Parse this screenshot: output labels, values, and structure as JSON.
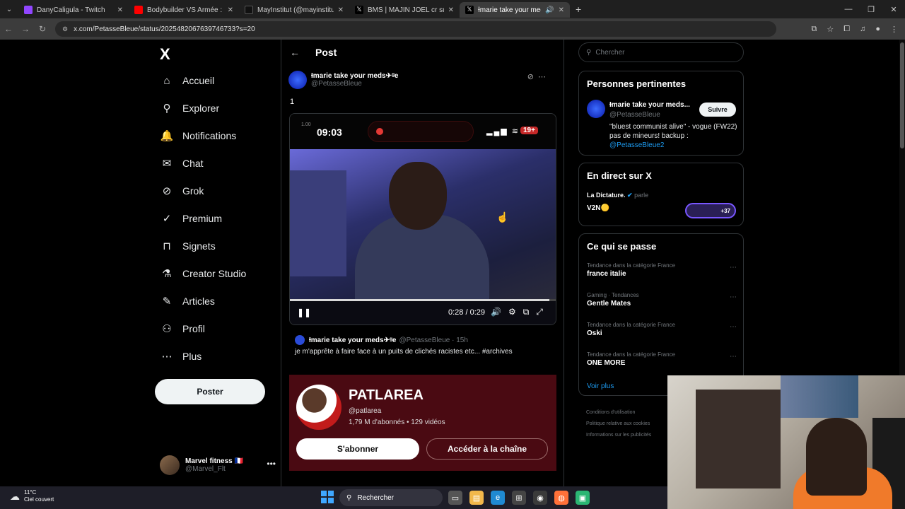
{
  "browser": {
    "tabs": [
      {
        "title": "DanyCaligula - Twitch",
        "color": "#9146ff"
      },
      {
        "title": "Bodybuilder VS Armée : qui ser",
        "color": "#ff0000"
      },
      {
        "title": "MayInstitut (@mayinstitut) | Tik",
        "color": "#111111"
      },
      {
        "title": "BMS | MAJIN JOEL cr sur X : \"@",
        "color": "#000000"
      },
      {
        "title": "Ɨmarie take your meds✈ᵍe",
        "color": "#000000"
      }
    ],
    "url": "x.com/PetasseBleue/status/2025482067639746733?s=20"
  },
  "nav": {
    "logo": "X",
    "items": [
      {
        "label": "Accueil",
        "icon": "⌂"
      },
      {
        "label": "Explorer",
        "icon": "⚲"
      },
      {
        "label": "Notifications",
        "icon": "🔔"
      },
      {
        "label": "Chat",
        "icon": "✉"
      },
      {
        "label": "Grok",
        "icon": "⊘"
      },
      {
        "label": "Premium",
        "icon": "✓"
      },
      {
        "label": "Signets",
        "icon": "⊓"
      },
      {
        "label": "Creator Studio",
        "icon": "⚗"
      },
      {
        "label": "Articles",
        "icon": "✎"
      },
      {
        "label": "Profil",
        "icon": "⚇"
      },
      {
        "label": "Plus",
        "icon": "⋯"
      }
    ],
    "post_button": "Poster",
    "account": {
      "name": "Marvel fitness 🇫🇷",
      "handle": "@Marvel_Flt"
    }
  },
  "main": {
    "header": "Post",
    "tweet": {
      "name": "Ɨmarie take your meds✈ᵍe",
      "handle": "@PetasseBleue",
      "text": "1"
    },
    "video": {
      "phone_time": "09:03",
      "phone_small": "1.00",
      "battery": "19+",
      "time": "0:28 / 0:29",
      "progress": 0.97
    },
    "quote": {
      "name": "Ɨmarie take your meds✈ᵍe",
      "handle": "@PetasseBleue · 15h",
      "text": "je m'apprête à faire face à un puits de clichés racistes etc... #archives"
    },
    "youtube": {
      "channel": "PATLAREA",
      "handle": "@patlarea",
      "stats": "1,79 M d'abonnés • 129 vidéos",
      "subscribe": "S'abonner",
      "visit": "Accéder à la chaîne"
    }
  },
  "right": {
    "search_placeholder": "Chercher",
    "relevant": {
      "title": "Personnes pertinentes",
      "name": "Ɨmarie take your meds...",
      "handle": "@PetasseBleue",
      "follow": "Suivre",
      "bio": "\"bluest communist alive\" - vogue (FW22) pas de mineurs! backup :",
      "bio_link": "@PetasseBleue2"
    },
    "live": {
      "title": "En direct sur X",
      "host": "La Dictature.",
      "host_suffix": "parle",
      "space": "V2N🟡",
      "listeners": "+37"
    },
    "trends": {
      "title": "Ce qui se passe",
      "items": [
        {
          "category": "Tendance dans la catégorie France",
          "topic": "france italie"
        },
        {
          "category": "Gaming · Tendances",
          "topic": "Gentle Mates"
        },
        {
          "category": "Tendance dans la catégorie France",
          "topic": "Oski"
        },
        {
          "category": "Tendance dans la catégorie France",
          "topic": "ONE MORE"
        }
      ],
      "more": "Voir plus"
    },
    "footer": [
      "Conditions d'utilisation",
      "Politique relative aux cookies",
      "Informations sur les publicités"
    ]
  },
  "taskbar": {
    "temp": "11°C",
    "weather": "Ciel couvert",
    "search": "Rechercher"
  }
}
